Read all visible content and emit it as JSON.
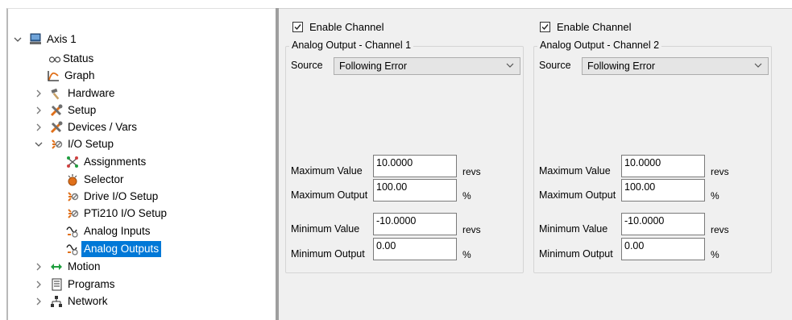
{
  "tree": {
    "items": [
      {
        "label": "Axis 1",
        "icon": "computer-icon",
        "expander": "expanded"
      },
      {
        "label": "Status",
        "icon": "glasses-icon",
        "expander": "none"
      },
      {
        "label": "Graph",
        "icon": "graph-icon",
        "expander": "none"
      },
      {
        "label": "Hardware",
        "icon": "hammer-icon",
        "expander": "collapsed"
      },
      {
        "label": "Setup",
        "icon": "tools-icon",
        "expander": "collapsed"
      },
      {
        "label": "Devices / Vars",
        "icon": "tools-icon",
        "expander": "collapsed"
      },
      {
        "label": "I/O Setup",
        "icon": "io-icon",
        "expander": "expanded"
      },
      {
        "label": "Assignments",
        "icon": "assignments-icon",
        "expander": "none"
      },
      {
        "label": "Selector",
        "icon": "selector-icon",
        "expander": "none"
      },
      {
        "label": "Drive I/O Setup",
        "icon": "io-icon",
        "expander": "none"
      },
      {
        "label": "PTi210 I/O Setup",
        "icon": "io-icon",
        "expander": "none"
      },
      {
        "label": "Analog Inputs",
        "icon": "analog-icon",
        "expander": "none"
      },
      {
        "label": "Analog Outputs",
        "icon": "analog-icon",
        "expander": "none",
        "selected": true
      },
      {
        "label": "Motion",
        "icon": "motion-arrows-icon",
        "expander": "collapsed"
      },
      {
        "label": "Programs",
        "icon": "document-icon",
        "expander": "collapsed"
      },
      {
        "label": "Network",
        "icon": "network-icon",
        "expander": "collapsed"
      }
    ]
  },
  "channels": [
    {
      "enable_label": "Enable Channel",
      "enabled": true,
      "group_title": "Analog Output - Channel 1",
      "source_label": "Source",
      "source_value": "Following Error",
      "max_value_label": "Maximum Value",
      "max_value": "10.0000",
      "max_value_unit": "revs",
      "max_output_label": "Maximum Output",
      "max_output": "100.00",
      "max_output_unit": "%",
      "min_value_label": "Minimum Value",
      "min_value": "-10.0000",
      "min_value_unit": "revs",
      "min_output_label": "Minimum Output",
      "min_output": "0.00",
      "min_output_unit": "%"
    },
    {
      "enable_label": "Enable Channel",
      "enabled": true,
      "group_title": "Analog Output - Channel 2",
      "source_label": "Source",
      "source_value": "Following Error",
      "max_value_label": "Maximum Value",
      "max_value": "10.0000",
      "max_value_unit": "revs",
      "max_output_label": "Maximum Output",
      "max_output": "100.00",
      "max_output_unit": "%",
      "min_value_label": "Minimum Value",
      "min_value": "-10.0000",
      "min_value_unit": "revs",
      "min_output_label": "Minimum Output",
      "min_output": "0.00",
      "min_output_unit": "%"
    }
  ],
  "colors": {
    "selection": "#0078d7",
    "panel_background": "#f0f0f0"
  }
}
